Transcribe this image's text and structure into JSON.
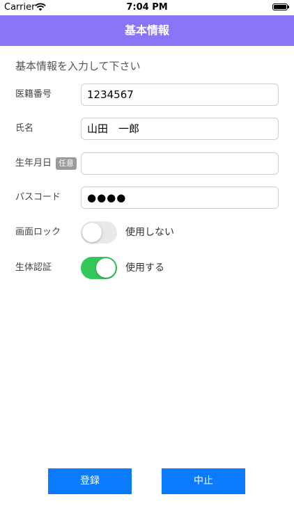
{
  "status_bar": {
    "carrier": "Carrier",
    "time": "7:04 PM"
  },
  "nav": {
    "title": "基本情報"
  },
  "section_header": "基本情報を入力して下さい",
  "form": {
    "record_number": {
      "label": "医籍番号",
      "value": "1234567"
    },
    "name": {
      "label": "氏名",
      "value": "山田　一郎"
    },
    "birthdate": {
      "label": "生年月日",
      "badge": "任意",
      "value": ""
    },
    "passcode": {
      "label": "パスコード",
      "value": "●●●●"
    },
    "screen_lock": {
      "label": "画面ロック",
      "enabled": false,
      "state_text": "使用しない"
    },
    "biometric": {
      "label": "生体認証",
      "enabled": true,
      "state_text": "使用する"
    }
  },
  "buttons": {
    "register": "登録",
    "cancel": "中止"
  },
  "colors": {
    "nav_background": "#8B74F5",
    "button_blue": "#0A7AFF",
    "toggle_on": "#34c759",
    "toggle_off": "#e9e9eb",
    "badge_gray": "#9b9b9b"
  }
}
